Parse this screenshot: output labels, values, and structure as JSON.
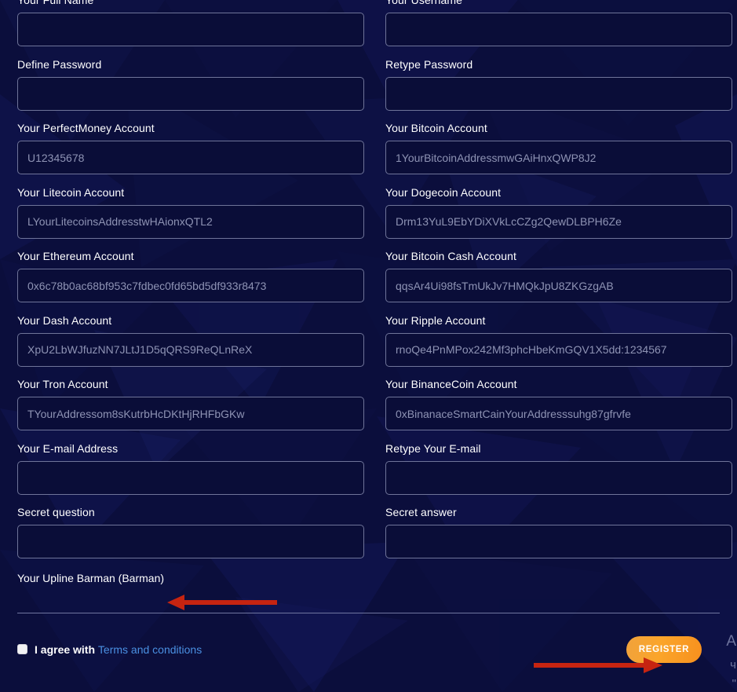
{
  "page": {
    "background_color": "#0b0e3c",
    "input_border_color": "#6f7499",
    "accent_color": "#f7901e",
    "link_color": "#4a90e2"
  },
  "form": {
    "fields": [
      {
        "label": "Your Full Name",
        "placeholder": "",
        "value": "",
        "type": "text",
        "column": "left"
      },
      {
        "label": "Your Username",
        "placeholder": "",
        "value": "",
        "type": "text",
        "column": "right"
      },
      {
        "label": "Define Password",
        "placeholder": "",
        "value": "",
        "type": "password",
        "column": "left"
      },
      {
        "label": "Retype Password",
        "placeholder": "",
        "value": "",
        "type": "password",
        "column": "right"
      },
      {
        "label": "Your PerfectMoney Account",
        "placeholder": "U12345678",
        "value": "",
        "type": "text",
        "column": "left"
      },
      {
        "label": "Your Bitcoin Account",
        "placeholder": "1YourBitcoinAddressmwGAiHnxQWP8J2",
        "value": "",
        "type": "text",
        "column": "right"
      },
      {
        "label": "Your Litecoin Account",
        "placeholder": "LYourLitecoinsAddresstwHAionxQTL2",
        "value": "",
        "type": "text",
        "column": "left"
      },
      {
        "label": "Your Dogecoin Account",
        "placeholder": "Drm13YuL9EbYDiXVkLcCZg2QewDLBPH6Ze",
        "value": "",
        "type": "text",
        "column": "right"
      },
      {
        "label": "Your Ethereum Account",
        "placeholder": "0x6c78b0ac68bf953c7fdbec0fd65bd5df933r8473",
        "value": "",
        "type": "text",
        "column": "left"
      },
      {
        "label": "Your Bitcoin Cash Account",
        "placeholder": "qqsAr4Ui98fsTmUkJv7HMQkJpU8ZKGzgAB",
        "value": "",
        "type": "text",
        "column": "right"
      },
      {
        "label": "Your Dash Account",
        "placeholder": "XpU2LbWJfuzNN7JLtJ1D5qQRS9ReQLnReX",
        "value": "",
        "type": "text",
        "column": "left"
      },
      {
        "label": "Your Ripple Account",
        "placeholder": "rnoQe4PnMPox242Mf3phcHbeKmGQV1X5dd:1234567",
        "value": "",
        "type": "text",
        "column": "right"
      },
      {
        "label": "Your Tron Account",
        "placeholder": "TYourAddressom8sKutrbHcDKtHjRHFbGKw",
        "value": "",
        "type": "text",
        "column": "left"
      },
      {
        "label": "Your BinanceCoin Account",
        "placeholder": "0xBinanaceSmartCainYourAddresssuhg87gfrvfe",
        "value": "",
        "type": "text",
        "column": "right"
      },
      {
        "label": "Your E-mail Address",
        "placeholder": "",
        "value": "",
        "type": "email",
        "column": "left"
      },
      {
        "label": "Retype Your E-mail",
        "placeholder": "",
        "value": "",
        "type": "email",
        "column": "right"
      },
      {
        "label": "Secret question",
        "placeholder": "",
        "value": "",
        "type": "text",
        "column": "left"
      },
      {
        "label": "Secret answer",
        "placeholder": "",
        "value": "",
        "type": "text",
        "column": "right"
      }
    ],
    "upline_text": "Your Upline Barman (Barman)"
  },
  "footer": {
    "agree_text": "I agree with",
    "terms_label": "Terms and conditions",
    "checkbox_checked": false,
    "register_label": "REGISTER"
  },
  "annotations": [
    {
      "name": "arrow-to-upline",
      "direction": "left",
      "color": "#c62411"
    },
    {
      "name": "arrow-to-register",
      "direction": "right",
      "color": "#c62411"
    }
  ],
  "edge_text": {
    "line1": "A",
    "line2": "ч",
    "line3": "\""
  }
}
